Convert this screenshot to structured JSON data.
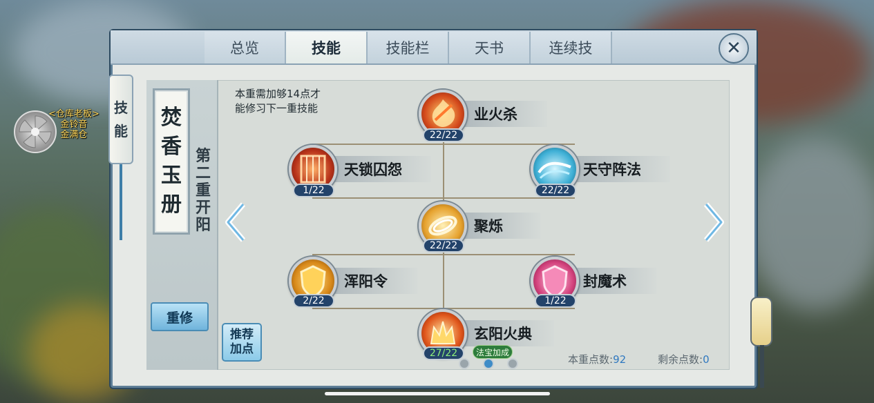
{
  "npc": {
    "title": "<仓库老板>",
    "name_line1": "金铃音",
    "name_line2": "金满仓"
  },
  "tabs": [
    {
      "label": "总览",
      "active": false
    },
    {
      "label": "技能",
      "active": true
    },
    {
      "label": "技能栏",
      "active": false
    },
    {
      "label": "天书",
      "active": false
    },
    {
      "label": "连续技",
      "active": false
    }
  ],
  "side_tag": {
    "char1": "技",
    "char2": "能"
  },
  "book": {
    "cover_chars": [
      "焚",
      "香",
      "玉",
      "册"
    ],
    "chapter_chars": [
      "第",
      "二",
      "重",
      "开",
      "阳"
    ]
  },
  "buttons": {
    "reset": "重修",
    "recommend_line1": "推荐",
    "recommend_line2": "加点"
  },
  "requirement": {
    "line1": "本重需加够14点才",
    "line2": "能修习下一重技能"
  },
  "skills": [
    {
      "name": "业火杀",
      "level": "22/22",
      "icon": "fire-bird-icon"
    },
    {
      "name": "天锁囚怨",
      "level": "1/22",
      "icon": "chains-icon"
    },
    {
      "name": "天守阵法",
      "level": "22/22",
      "icon": "water-wave-icon"
    },
    {
      "name": "聚烁",
      "level": "22/22",
      "icon": "golden-swirl-icon"
    },
    {
      "name": "浑阳令",
      "level": "2/22",
      "icon": "golden-shield-icon"
    },
    {
      "name": "封魔术",
      "level": "1/22",
      "icon": "pink-shield-icon"
    },
    {
      "name": "玄阳火典",
      "level": "27/22",
      "icon": "flame-crown-icon"
    }
  ],
  "fabao_badge": "法宝加成",
  "points": {
    "current_label": "本重点数:",
    "current_value": "92",
    "remaining_label": "剩余点数:",
    "remaining_value": "0"
  },
  "pagination": {
    "pages": 3,
    "active_index": 1
  },
  "colors": {
    "accent_blue": "#3f8cc7",
    "level_bg": "#23436a",
    "bonus_green": "#8ef07a"
  }
}
